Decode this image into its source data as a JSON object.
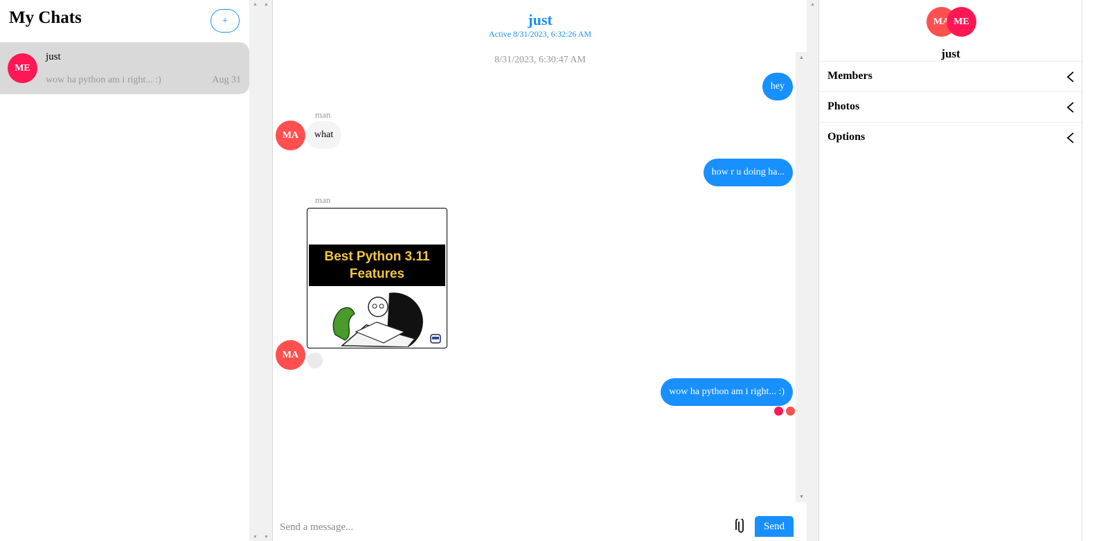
{
  "left_panel": {
    "title": "My Chats",
    "new_chat_label": "+",
    "chats": [
      {
        "avatar": "ME",
        "name": "just",
        "preview": "wow ha python am i right... :)",
        "date": "Aug 31",
        "selected": true
      }
    ]
  },
  "chat": {
    "title": "just",
    "active": "Active 8/31/2023, 6:32:26 AM",
    "timestamp": "8/31/2023, 6:30:47 AM",
    "messages": [
      {
        "from": "me",
        "text": "hey"
      },
      {
        "from": "them",
        "sender": "man",
        "avatar": "MA",
        "text": "what"
      },
      {
        "from": "me",
        "text": "how r u doing ha..."
      },
      {
        "from": "them",
        "sender": "man",
        "avatar": "MA",
        "image_text": "Best Python 3.11 Features"
      },
      {
        "from": "me",
        "text": "wow ha python am i right... :)"
      }
    ],
    "read_receipts": [
      "#ff1654",
      "#ff4f4f"
    ],
    "composer": {
      "placeholder": "Send a message...",
      "send_label": "Send"
    }
  },
  "details": {
    "avatars": [
      "MA",
      "ME"
    ],
    "title": "just",
    "sections": [
      "Members",
      "Photos",
      "Options"
    ]
  },
  "colors": {
    "accent": "#1890ff",
    "avatar_me": "#ff1654",
    "avatar_ma": "#ff4f4f",
    "selected_bg": "#d9d9d9"
  },
  "icons": [
    "plus-icon",
    "paperclip-icon",
    "chevron-left-icon",
    "scroll-arrow-up-icon",
    "scroll-arrow-down-icon"
  ]
}
